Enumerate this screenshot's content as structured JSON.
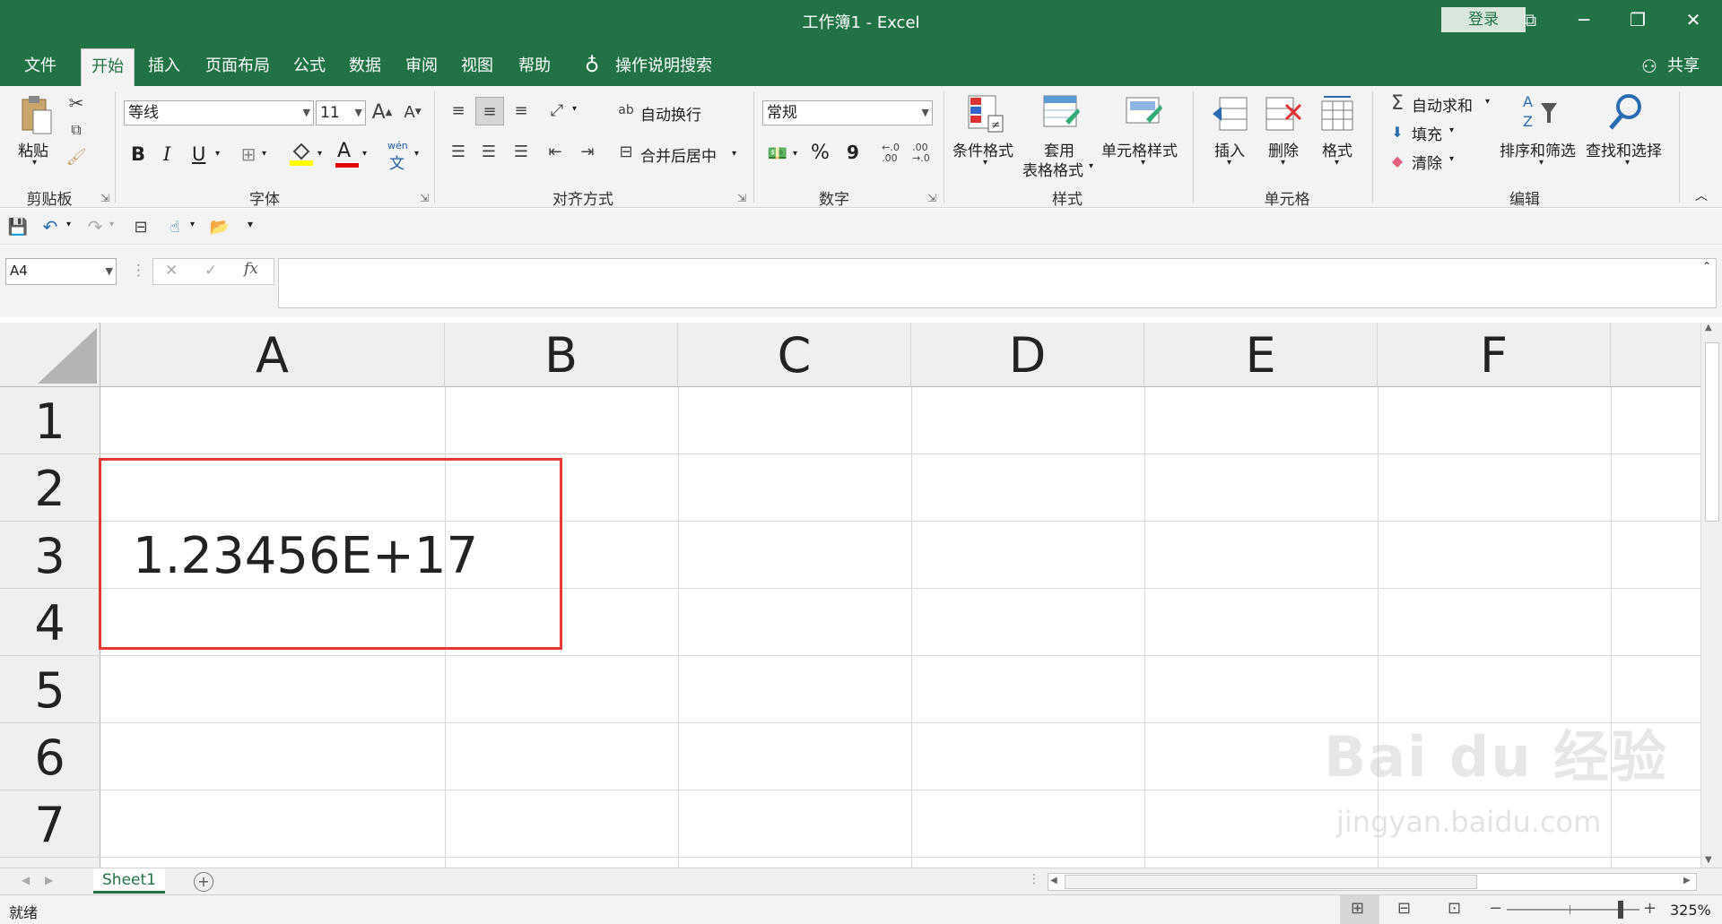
{
  "window": {
    "title": "工作簿1  -  Excel",
    "login_label": "登录"
  },
  "tabs": [
    "文件",
    "开始",
    "插入",
    "页面布局",
    "公式",
    "数据",
    "审阅",
    "视图",
    "帮助"
  ],
  "search_label": "操作说明搜索",
  "share_label": "共享",
  "ribbon": {
    "clipboard": {
      "paste": "粘贴",
      "group": "剪贴板"
    },
    "font": {
      "name": "等线",
      "size": "11",
      "bold": "B",
      "italic": "I",
      "underline": "U",
      "font_color": "A",
      "phonetic_top": "wén",
      "phonetic_bottom": "文",
      "group": "字体"
    },
    "alignment": {
      "wrap": "自动换行",
      "merge": "合并后居中",
      "group": "对齐方式"
    },
    "number": {
      "format": "常规",
      "percent": "%",
      "comma": "9",
      "group": "数字"
    },
    "styles": {
      "conditional": "条件格式",
      "table_1": "套用",
      "table_2": "表格格式",
      "cell_styles": "单元格样式",
      "group": "样式"
    },
    "cells": {
      "insert": "插入",
      "delete": "删除",
      "format": "格式",
      "group": "单元格"
    },
    "editing": {
      "autosum": "自动求和",
      "fill": "填充",
      "clear": "清除",
      "sort": "排序和筛选",
      "find": "查找和选择",
      "group": "编辑"
    }
  },
  "formula_bar": {
    "name_box": "A4",
    "fx": "fx",
    "formula": ""
  },
  "columns": [
    "A",
    "B",
    "C",
    "D",
    "E",
    "F"
  ],
  "rows": [
    "1",
    "2",
    "3",
    "4",
    "5",
    "6",
    "7"
  ],
  "cell_a3": "1.23456E+17",
  "sheet_tab": "Sheet1",
  "status": {
    "ready": "就绪",
    "zoom": "325%"
  },
  "watermark": {
    "brand": "Bai du 经验",
    "url": "jingyan.baidu.com"
  },
  "colors": {
    "accent": "#217346",
    "selection_box": "#e53935"
  }
}
